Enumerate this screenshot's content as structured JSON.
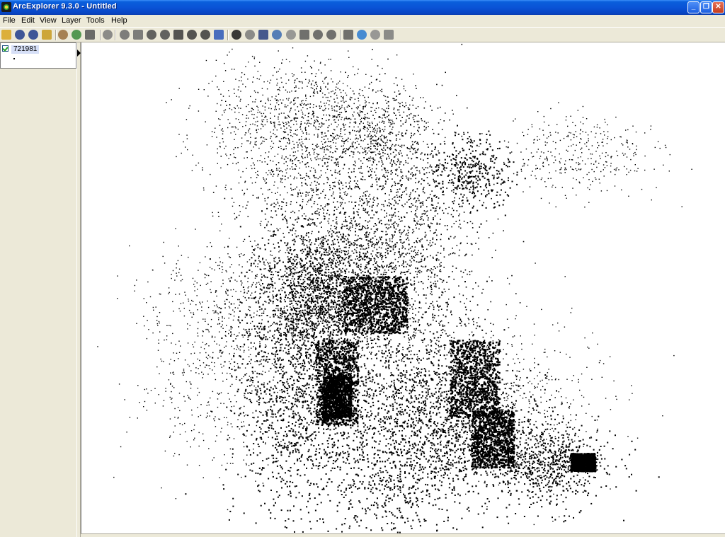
{
  "window": {
    "title": "ArcExplorer 9.3.0 - Untitled",
    "min_symbol": "_",
    "max_symbol": "❐",
    "close_symbol": "✕"
  },
  "menu": [
    "File",
    "Edit",
    "View",
    "Layer",
    "Tools",
    "Help"
  ],
  "toolbar": [
    {
      "name": "open-folder-icon",
      "color": "#d9a520"
    },
    {
      "name": "save-icon",
      "color": "#203c8c"
    },
    {
      "name": "save-all-icon",
      "color": "#203c8c"
    },
    {
      "name": "folder-icon",
      "color": "#c89a1e"
    },
    {
      "name": "add-data-icon",
      "color": "#9a6f3c"
    },
    {
      "name": "layer-properties-icon",
      "color": "#3a8a3a"
    },
    {
      "name": "print-icon",
      "color": "#555555"
    },
    {
      "name": "stop-icon",
      "color": "#7a7a7a"
    },
    {
      "name": "back-icon",
      "color": "#6a6a6a"
    },
    {
      "name": "forward-icon",
      "color": "#6a6a6a"
    },
    {
      "name": "full-extent-icon",
      "color": "#4a4a4a"
    },
    {
      "name": "zoom-to-layer-icon",
      "color": "#4a4a4a"
    },
    {
      "name": "zoom-in-icon",
      "color": "#3a3a3a"
    },
    {
      "name": "zoom-out-icon",
      "color": "#3a3a3a"
    },
    {
      "name": "pan-icon",
      "color": "#3a3a3a"
    },
    {
      "name": "globe-icon",
      "color": "#2b57b8"
    },
    {
      "name": "identify-icon",
      "color": "#1a1a1a"
    },
    {
      "name": "select-icon",
      "color": "#7a7a7a"
    },
    {
      "name": "find-icon",
      "color": "#2a3f80"
    },
    {
      "name": "query-icon",
      "color": "#3a6ab0"
    },
    {
      "name": "chart-icon",
      "color": "#8a8a8a"
    },
    {
      "name": "measure-icon",
      "color": "#5a5a5a"
    },
    {
      "name": "buffer-icon",
      "color": "#5a5a5a"
    },
    {
      "name": "properties-icon",
      "color": "#5a5a5a"
    },
    {
      "name": "eraser-icon",
      "color": "#5a5a5a"
    },
    {
      "name": "hyperlink-icon",
      "color": "#2a7ad0"
    },
    {
      "name": "grid-icon",
      "color": "#8a8a8a"
    },
    {
      "name": "table-icon",
      "color": "#7a7a7a"
    }
  ],
  "toc": {
    "layer_name": "721981",
    "layer_checked": true
  },
  "map": {
    "layer": "721981",
    "point_color": "#000000",
    "background": "#ffffff"
  }
}
